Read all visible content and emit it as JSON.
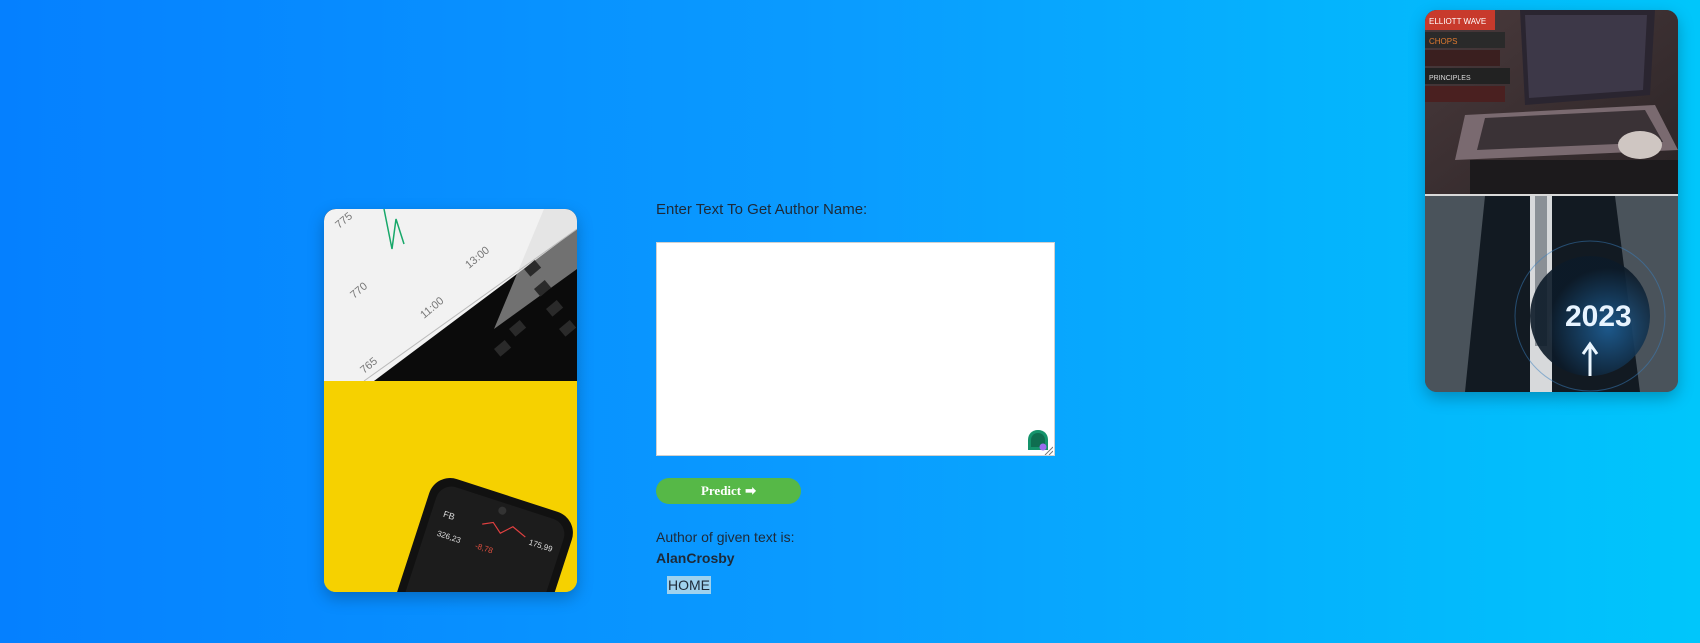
{
  "form": {
    "prompt_label": "Enter Text To Get Author Name:",
    "text_value": "",
    "text_placeholder": "",
    "predict_label": "Predict",
    "predict_icon": "arrow-right-icon",
    "result_label": "Author of given text is:",
    "result_value": "AlanCrosby"
  },
  "nav": {
    "home_label": "HOME"
  },
  "images": {
    "left_top": "stock-chart-on-laptop",
    "left_bottom": "phone-stock-app-on-yellow",
    "right_top": "laptop-with-books",
    "right_bottom": "2023-growth-arrow"
  },
  "colors": {
    "background_start": "#0580ff",
    "background_end": "#00c6fb",
    "predict_button": "#56b847",
    "home_highlight": "#9fd2ee"
  }
}
